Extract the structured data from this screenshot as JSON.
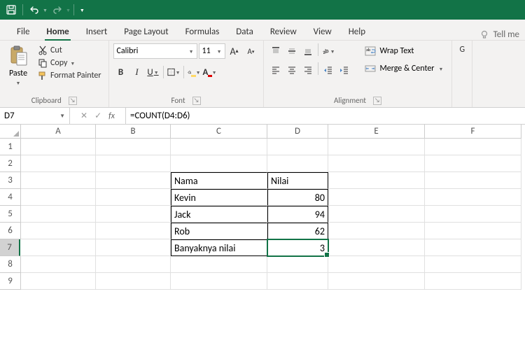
{
  "qat": {
    "save": "save",
    "undo": "undo",
    "redo": "redo"
  },
  "tabs": [
    "File",
    "Home",
    "Insert",
    "Page Layout",
    "Formulas",
    "Data",
    "Review",
    "View",
    "Help"
  ],
  "active_tab": "Home",
  "tell_me": "Tell me",
  "ribbon": {
    "clipboard": {
      "label": "Clipboard",
      "paste": "Paste",
      "cut": "Cut",
      "copy": "Copy",
      "format_painter": "Format Painter"
    },
    "font": {
      "label": "Font",
      "name": "Calibri",
      "size": "11"
    },
    "alignment": {
      "label": "Alignment",
      "wrap": "Wrap Text",
      "merge": "Merge & Center"
    },
    "general": {
      "label": "G"
    }
  },
  "name_box": "D7",
  "formula": "=COUNT(D4:D6)",
  "columns": [
    "A",
    "B",
    "C",
    "D",
    "E",
    "F"
  ],
  "rows": [
    "1",
    "2",
    "3",
    "4",
    "5",
    "6",
    "7",
    "8",
    "9"
  ],
  "cells": {
    "C3": "Nama",
    "D3": "Nilai",
    "C4": "Kevin",
    "D4": "80",
    "C5": "Jack",
    "D5": "94",
    "C6": "Rob",
    "D6": "62",
    "C7": "Banyaknya nilai",
    "D7": "3"
  },
  "active_cell": "D7"
}
